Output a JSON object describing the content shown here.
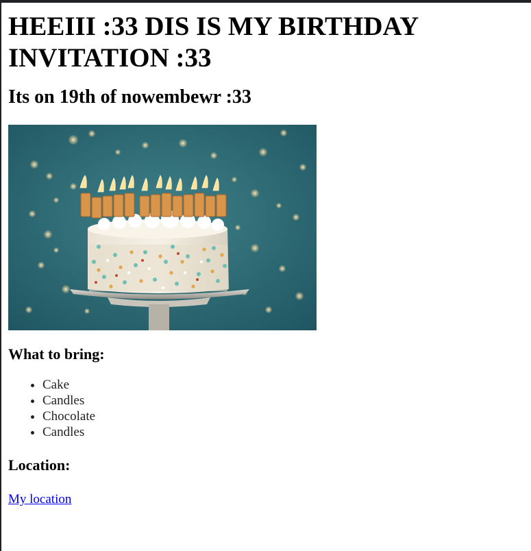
{
  "page": {
    "heading": "HEEIII :33 DIS IS MY BIRTHDAY INVITATION :33",
    "date_line": "Its on 19th of nowembewr :33",
    "image_subject": "birthday-cake-with-happy-birthday-candles",
    "bring_heading": "What to bring:",
    "bring_items": [
      "Cake",
      "Candles",
      "Chocolate",
      "Candles"
    ],
    "location_heading": "Location:",
    "location_link": "My location"
  },
  "colors": {
    "link": "#0000ee",
    "frame": "#202124",
    "photo_background": "#2f6e77",
    "frosting": "#f4efe4",
    "candle_gold": "#d9964a"
  }
}
